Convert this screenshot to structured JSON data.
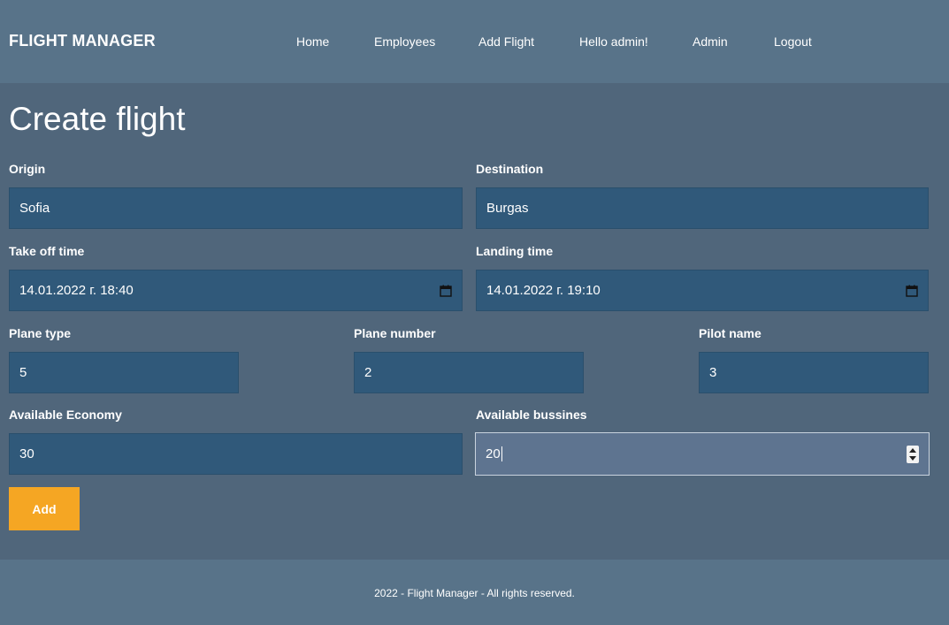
{
  "navbar": {
    "brand": "FLIGHT MANAGER",
    "links": [
      {
        "label": "Home"
      },
      {
        "label": "Employees"
      },
      {
        "label": "Add Flight"
      },
      {
        "label": "Hello admin!"
      },
      {
        "label": "Admin"
      },
      {
        "label": "Logout"
      }
    ]
  },
  "form": {
    "title": "Create flight",
    "origin": {
      "label": "Origin",
      "value": "Sofia"
    },
    "destination": {
      "label": "Destination",
      "value": "Burgas"
    },
    "takeoff": {
      "label": "Take off time",
      "value": "14.01.2022 г. 18:40",
      "icon": "calendar-icon"
    },
    "landing": {
      "label": "Landing time",
      "value": "14.01.2022 г. 19:10",
      "icon": "calendar-icon"
    },
    "plane_type": {
      "label": "Plane type",
      "value": "5"
    },
    "plane_number": {
      "label": "Plane number",
      "value": "2"
    },
    "pilot_name": {
      "label": "Pilot name",
      "value": "3"
    },
    "economy": {
      "label": "Available Economy",
      "value": "30"
    },
    "business": {
      "label": "Available bussines",
      "value": "20",
      "icon": "spinner-icon"
    },
    "submit_label": "Add"
  },
  "footer": {
    "text": "2022 - Flight Manager - All rights reserved."
  },
  "colors": {
    "background": "#50667b",
    "navbar": "#587389",
    "input": "#30597a",
    "input_focused": "#5e7490",
    "button": "#f5a623"
  }
}
